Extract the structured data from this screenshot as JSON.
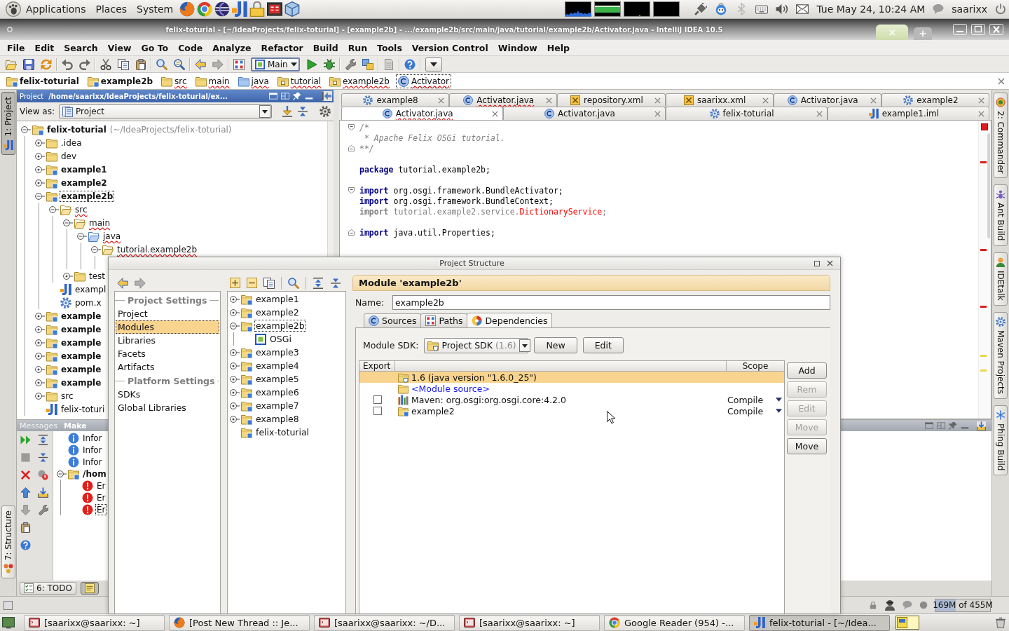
{
  "top_panel": {
    "menus": [
      "Applications",
      "Places",
      "System"
    ],
    "clock": "Tue May 24, 10:24 AM",
    "user": "saarixx"
  },
  "window": {
    "title": "felix-toturial - [~/IdeaProjects/felix-toturial] - [example2b] - .../example2b/src/main/java/tutorial/example2b/Activator.java - IntelliJ IDEA 10.5"
  },
  "menu_bar": [
    "File",
    "Edit",
    "Search",
    "View",
    "Go To",
    "Code",
    "Analyze",
    "Refactor",
    "Build",
    "Run",
    "Tools",
    "Version Control",
    "Window",
    "Help"
  ],
  "toolbar": {
    "run_configuration": "Main"
  },
  "navigation_bar": {
    "crumbs": [
      {
        "label": "felix-toturial",
        "kind": "module",
        "selected": false
      },
      {
        "label": "example2b",
        "kind": "module",
        "selected": false
      },
      {
        "label": "src",
        "kind": "folder",
        "problem": true,
        "selected": false
      },
      {
        "label": "main",
        "kind": "folder",
        "problem": true,
        "selected": false
      },
      {
        "label": "java",
        "kind": "source",
        "problem": true,
        "selected": false
      },
      {
        "label": "tutorial",
        "kind": "package",
        "problem": true,
        "selected": false
      },
      {
        "label": "example2b",
        "kind": "package",
        "problem": true,
        "selected": false
      },
      {
        "label": "Activator",
        "kind": "class",
        "problem": true,
        "selected": true
      }
    ]
  },
  "tool_strip_left": [
    {
      "label": "1: Project",
      "kind": "project",
      "selected": true
    },
    {
      "label": "7: Structure",
      "kind": "structure",
      "selected": false
    }
  ],
  "project_panel": {
    "title": "Project",
    "path": "/home/saarixx/IdeaProjects/felix-toturial/ex...",
    "view_as_label": "View as:",
    "view_as": "Project",
    "tree": [
      {
        "label": "felix-toturial",
        "suffix": "(~/IdeaProjects/felix-toturial)",
        "kind": "module",
        "expanded": true,
        "selected": false,
        "children": [
          {
            "label": ".idea",
            "kind": "folder",
            "expanded": false,
            "selected": false
          },
          {
            "label": "dev",
            "kind": "folder",
            "expanded": false,
            "selected": false
          },
          {
            "label": "example1",
            "kind": "module",
            "expanded": false,
            "selected": false
          },
          {
            "label": "example2",
            "kind": "module",
            "expanded": false,
            "selected": false
          },
          {
            "label": "example2b",
            "kind": "module",
            "expanded": true,
            "selected": true,
            "children": [
              {
                "label": "src",
                "kind": "folder",
                "problem": true,
                "expanded": true,
                "selected": false,
                "children": [
                  {
                    "label": "main",
                    "kind": "folder",
                    "problem": true,
                    "expanded": true,
                    "selected": false,
                    "children": [
                      {
                        "label": "java",
                        "kind": "source",
                        "problem": true,
                        "expanded": true,
                        "selected": false,
                        "children": [
                          {
                            "label": "tutorial.example2b",
                            "kind": "package",
                            "problem": true,
                            "expanded": true,
                            "selected": false
                          }
                        ]
                      }
                    ]
                  },
                  {
                    "label": "test",
                    "kind": "folder",
                    "expanded": false,
                    "selected": false
                  }
                ]
              },
              {
                "label": "exampl",
                "kind": "iml",
                "selected": false
              },
              {
                "label": "pom.x",
                "kind": "pom",
                "selected": false
              }
            ]
          },
          {
            "label": "example",
            "kind": "module",
            "expanded": false,
            "selected": false
          },
          {
            "label": "example",
            "kind": "module",
            "expanded": false,
            "selected": false
          },
          {
            "label": "example",
            "kind": "module",
            "expanded": false,
            "selected": false
          },
          {
            "label": "example",
            "kind": "module",
            "expanded": false,
            "selected": false
          },
          {
            "label": "example",
            "kind": "module",
            "expanded": false,
            "selected": false
          },
          {
            "label": "example",
            "kind": "module",
            "expanded": false,
            "selected": false
          },
          {
            "label": "src",
            "kind": "folder",
            "expanded": false,
            "selected": false
          },
          {
            "label": "felix-toturi",
            "kind": "iml",
            "selected": false
          }
        ]
      }
    ]
  },
  "editor": {
    "tab_rows": [
      {
        "tabs": [
          {
            "label": "example8",
            "kind": "module_settings",
            "selected": false
          },
          {
            "label": "Activator.java",
            "kind": "class",
            "problem": true,
            "selected": false
          },
          {
            "label": "repository.xml",
            "kind": "xml",
            "selected": false
          },
          {
            "label": "saarixx.xml",
            "kind": "xml",
            "selected": false
          },
          {
            "label": "Activator.java",
            "kind": "class",
            "selected": false
          },
          {
            "label": "example2",
            "kind": "module_settings",
            "selected": false
          }
        ]
      },
      {
        "tabs": [
          {
            "label": "Activator.java",
            "kind": "class",
            "problem": true,
            "selected": true
          },
          {
            "label": "Activator.java",
            "kind": "class",
            "selected": false
          },
          {
            "label": "felix-toturial",
            "kind": "module_settings",
            "selected": false
          },
          {
            "label": "example1.iml",
            "kind": "iml",
            "selected": false
          }
        ]
      }
    ],
    "lines": [
      {
        "fold_start": true,
        "tokens": [
          {
            "text": "/*",
            "kind": "comment"
          }
        ]
      },
      {
        "tokens": [
          {
            "text": " * Apache Felix OSGi tutorial.",
            "kind": "comment"
          }
        ]
      },
      {
        "fold_end": true,
        "tokens": [
          {
            "text": "**/",
            "kind": "comment"
          }
        ]
      },
      {
        "blank_before": true,
        "tokens": [
          {
            "text": "package",
            "kind": "keyword"
          },
          {
            "text": " tutorial.example2b;",
            "kind": "plain"
          }
        ]
      },
      {
        "blank_before": true,
        "fold_start": true,
        "tokens": [
          {
            "text": "import",
            "kind": "keyword"
          },
          {
            "text": " org.osgi.framework.BundleActivator;",
            "kind": "plain"
          }
        ]
      },
      {
        "tokens": [
          {
            "text": "import",
            "kind": "keyword"
          },
          {
            "text": " org.osgi.framework.BundleContext;",
            "kind": "plain"
          }
        ]
      },
      {
        "tokens": [
          {
            "text": "import",
            "kind": "unused_keyword"
          },
          {
            "text": " tutorial.example2.service.",
            "kind": "unused"
          },
          {
            "text": "DictionaryService",
            "kind": "error"
          },
          {
            "text": ";",
            "kind": "unused"
          }
        ]
      },
      {
        "blank_before": true,
        "fold_end": true,
        "tokens": [
          {
            "text": "import",
            "kind": "keyword"
          },
          {
            "text": " java.util.Properties;",
            "kind": "plain"
          }
        ]
      }
    ]
  },
  "tool_strip_right": [
    {
      "label": "2: Commander",
      "kind": "commander",
      "selected": false
    },
    {
      "label": "Ant Build",
      "kind": "ant",
      "selected": false
    },
    {
      "label": "IDEtalk",
      "kind": "idetalk",
      "selected": false
    },
    {
      "label": "Maven Projects",
      "kind": "maven",
      "selected": false
    },
    {
      "label": "Phing Build",
      "kind": "phing",
      "selected": false
    }
  ],
  "messages_panel": {
    "title": "Messages",
    "content_tab": "Make",
    "tree": [
      {
        "label": "Infor",
        "kind": "info",
        "selected": false
      },
      {
        "label": "Infor",
        "kind": "info",
        "selected": false
      },
      {
        "label": "Infor",
        "kind": "info",
        "selected": false
      },
      {
        "label": "/hom",
        "kind": "module",
        "expanded": true,
        "selected": false,
        "children": [
          {
            "label": "Er",
            "kind": "error",
            "selected": false
          },
          {
            "label": "Er",
            "kind": "error",
            "selected": false
          },
          {
            "label": "Er",
            "kind": "error",
            "selected": true
          }
        ]
      }
    ]
  },
  "bottom_tabs": [
    {
      "label": "6: TODO",
      "kind": "todo",
      "selected": false
    },
    {
      "kind": "messages",
      "selected": true
    }
  ],
  "status_bar": {
    "memory": {
      "reading": "169M of 455M",
      "level": 0.37
    }
  },
  "taskbar": {
    "tasks": [
      {
        "label": "[saarixx@saarixx: ~]",
        "kind": "terminal",
        "selected": false
      },
      {
        "label": "[Post New Thread :: Je...",
        "kind": "browser",
        "selected": false
      },
      {
        "label": "[saarixx@saarixx: ~/D...",
        "kind": "terminal",
        "selected": false
      },
      {
        "label": "[saarixx@saarixx: ~]",
        "kind": "terminal",
        "selected": false
      },
      {
        "label": "Google Reader (954) -...",
        "kind": "browser_alt",
        "selected": false
      },
      {
        "label": "felix-toturial - [~/Idea...",
        "kind": "ide",
        "selected": true
      }
    ]
  },
  "dialog": {
    "title": "Project Structure",
    "sections": [
      {
        "heading": "Project Settings",
        "items": [
          {
            "label": "Project",
            "selected": false
          },
          {
            "label": "Modules",
            "selected": true
          },
          {
            "label": "Libraries",
            "selected": false
          },
          {
            "label": "Facets",
            "selected": false
          },
          {
            "label": "Artifacts",
            "selected": false
          }
        ]
      },
      {
        "heading": "Platform Settings",
        "items": [
          {
            "label": "SDKs",
            "selected": false
          },
          {
            "label": "Global Libraries",
            "selected": false
          }
        ]
      }
    ],
    "module_tree": [
      {
        "label": "example1",
        "kind": "module",
        "expanded": false,
        "selected": false
      },
      {
        "label": "example2",
        "kind": "module",
        "expanded": false,
        "selected": false
      },
      {
        "label": "example2b",
        "kind": "module",
        "expanded": true,
        "selected": true,
        "children": [
          {
            "label": "OSGi",
            "kind": "facet",
            "selected": false
          }
        ]
      },
      {
        "label": "example3",
        "kind": "module",
        "expanded": false,
        "selected": false
      },
      {
        "label": "example4",
        "kind": "module",
        "expanded": false,
        "selected": false
      },
      {
        "label": "example5",
        "kind": "module",
        "expanded": false,
        "selected": false
      },
      {
        "label": "example6",
        "kind": "module",
        "expanded": false,
        "selected": false
      },
      {
        "label": "example7",
        "kind": "module",
        "expanded": false,
        "selected": false
      },
      {
        "label": "example8",
        "kind": "module",
        "expanded": false,
        "selected": false
      },
      {
        "label": "felix-toturial",
        "kind": "module",
        "selected": false
      }
    ],
    "header": "Module 'example2b'",
    "name_label": "Name:",
    "name_value": "example2b",
    "tabs": [
      {
        "label": "Sources",
        "kind": "sources",
        "selected": false
      },
      {
        "label": "Paths",
        "kind": "paths",
        "selected": false
      },
      {
        "label": "Dependencies",
        "kind": "dependencies",
        "selected": true
      }
    ],
    "sdk_label": "Module SDK:",
    "sdk": {
      "value": "Project SDK",
      "detail": "(1.6)"
    },
    "sdk_buttons": [
      "New",
      "Edit"
    ],
    "table": {
      "columns": {
        "export": "Export",
        "scope": "Scope"
      },
      "rows": [
        {
          "entry": "1.6 (java version \"1.6.0_25\")",
          "kind": "jdk",
          "selected": true
        },
        {
          "entry": "<Module source>",
          "kind": "module_source",
          "selected": false
        },
        {
          "entry": "Maven: org.osgi:org.osgi.core:4.2.0",
          "kind": "library",
          "checked": false,
          "scope": "Compile",
          "selected": false
        },
        {
          "entry": "example2",
          "kind": "module",
          "checked": false,
          "scope": "Compile",
          "selected": false
        }
      ]
    },
    "side_buttons": [
      {
        "label": "Add",
        "disabled": false
      },
      {
        "label": "Rem",
        "disabled": true
      },
      {
        "label": "Edit",
        "disabled": true
      },
      {
        "label": "Move",
        "disabled": true
      },
      {
        "label": "Move",
        "disabled": false
      }
    ]
  }
}
